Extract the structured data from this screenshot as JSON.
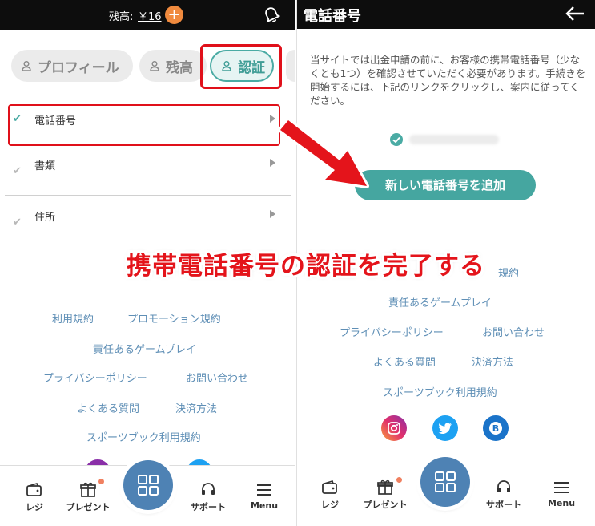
{
  "left_panel": {
    "header": {
      "balance_label": "残高:",
      "balance_value": "￥16",
      "add_symbol": "+",
      "bell_icon": "bell-icon"
    },
    "tabs": [
      {
        "label": "プロフィール",
        "icon": "person-icon"
      },
      {
        "label": "残高",
        "icon": "person-icon"
      },
      {
        "label": "認証",
        "icon": "person-icon",
        "active": true
      }
    ],
    "menu": [
      {
        "label": "電話番号",
        "checked_color": "#4aaba4"
      },
      {
        "label": "書類"
      },
      {
        "label": "住所"
      }
    ],
    "links": {
      "terms": "利用規約",
      "promo_terms": "プロモーション規約",
      "responsible": "責任あるゲームプレイ",
      "privacy": "プライバシーポリシー",
      "contact": "お問い合わせ",
      "faq": "よくある質問",
      "payment": "決済方法",
      "sportsbook": "スポーツブック利用規約"
    },
    "bottom_nav": {
      "wallet": "レジ",
      "present": "プレゼント",
      "support": "サポート",
      "menu": "Menu"
    }
  },
  "right_panel": {
    "header": {
      "title": "電話番号",
      "back_icon": "arrow-left-icon"
    },
    "description": "当サイトでは出金申請の前に、お客様の携帯電話番号（少なくとも1つ）を確認させていただく必要があります。手続きを開始するには、下記のリンクをクリックし、案内に従ってください。",
    "add_button": "新しい電話番号を追加",
    "links": {
      "promo_terms_partial": "規約",
      "responsible": "責任あるゲームプレイ",
      "privacy": "プライバシーポリシー",
      "contact": "お問い合わせ",
      "faq": "よくある質問",
      "payment": "決済方法",
      "sportsbook": "スポーツブック利用規約"
    },
    "social": [
      "instagram-icon",
      "twitter-icon",
      "blog-icon"
    ],
    "bottom_nav": {
      "wallet": "レジ",
      "present": "プレゼント",
      "support": "サポート",
      "menu": "Menu"
    }
  },
  "overlay": {
    "caption": "携帯電話番号の認証を完了する"
  },
  "colors": {
    "accent_teal": "#4aaba4",
    "link_blue": "#5f8fb6",
    "fab_blue": "#4e82b4",
    "annotation_red": "#e0101a",
    "orange": "#f08a3e"
  }
}
